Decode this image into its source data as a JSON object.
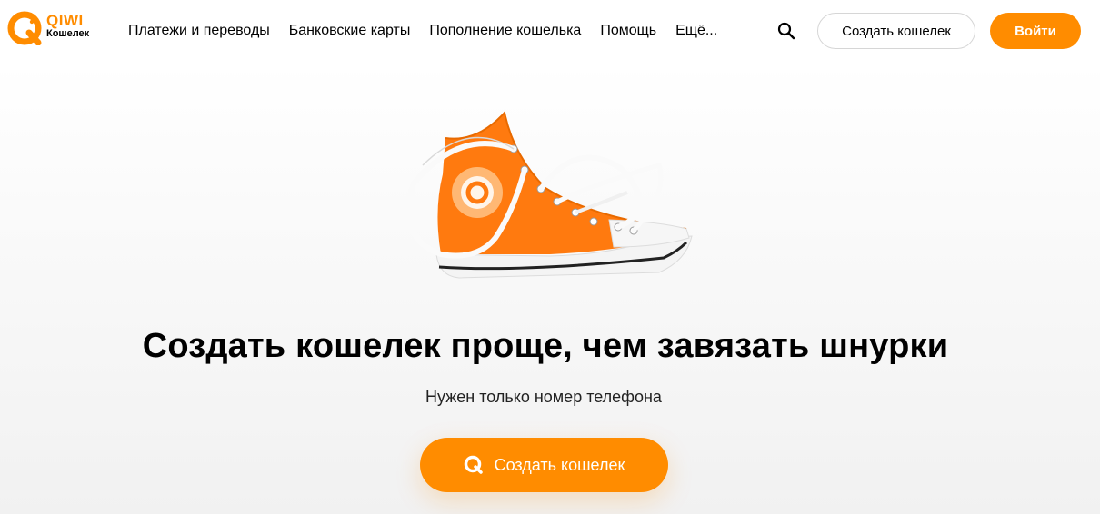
{
  "header": {
    "logo": {
      "brand": "QIWI",
      "sub": "Кошелек",
      "icon": "qiwi-logo-icon"
    },
    "nav": [
      {
        "label": "Платежи и переводы"
      },
      {
        "label": "Банковские карты"
      },
      {
        "label": "Пополнение кошелька"
      },
      {
        "label": "Помощь"
      },
      {
        "label": "Ещё..."
      }
    ],
    "search_icon": "search-icon",
    "create_wallet_label": "Создать кошелек",
    "login_label": "Войти"
  },
  "hero": {
    "image": "orange-sneaker-illustration",
    "title": "Создать кошелек проще, чем завязать шнурки",
    "subtitle": "Нужен только номер телефона",
    "cta_label": "Создать кошелек",
    "cta_icon": "qiwi-logo-icon"
  },
  "colors": {
    "accent": "#ff8c00",
    "text": "#000000",
    "background": "#ffffff"
  }
}
